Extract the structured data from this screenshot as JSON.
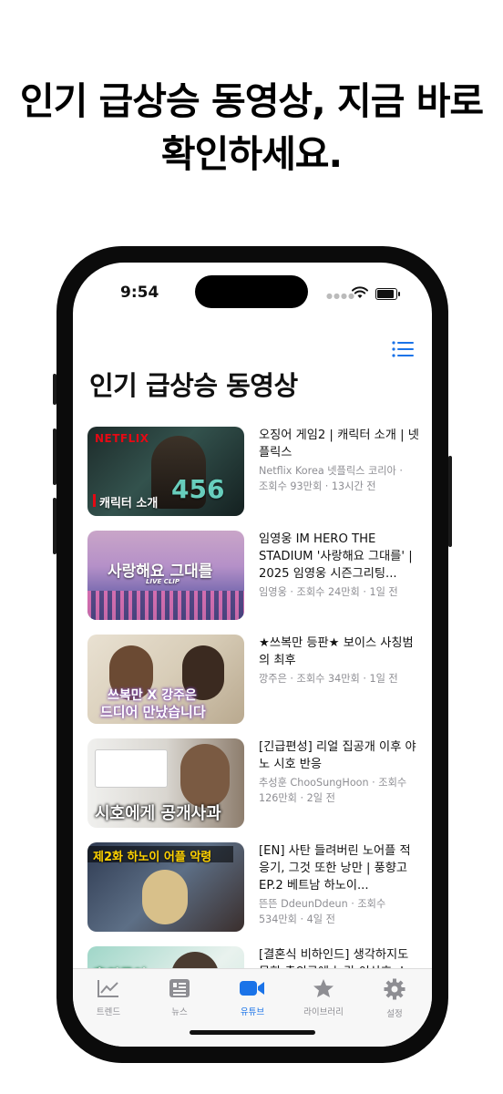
{
  "headline": {
    "line1": "인기 급상승 동영상, 지금 바로",
    "line2": "확인하세요."
  },
  "status_bar": {
    "time": "9:54"
  },
  "page": {
    "title": "인기 급상승 동영상"
  },
  "videos": [
    {
      "title": "오징어 게임2 | 캐릭터 소개 | 넷플릭스",
      "sub1": "Netflix Korea 넷플릭스 코리아 ·",
      "sub2": "조회수 93만회 · 13시간 전",
      "thumb_brand": "NETFLIX",
      "thumb_caption": "캐릭터 소개",
      "thumb_number": "456"
    },
    {
      "title": "임영웅 IM HERO THE STADIUM '사랑해요 그대를' | 2025 임영웅 시즌그리팅...",
      "sub1": "임영웅 · 조회수 24만회 · 1일 전",
      "sub2": "",
      "thumb_caption": "사랑해요 그대를",
      "thumb_small": "LIVE CLIP"
    },
    {
      "title": "★쓰복만 등판★ 보이스 사칭범의 최후",
      "sub1": "깡주은 · 조회수 34만회 · 1일 전",
      "sub2": "",
      "thumb_caption1": "쓰복만 X 강주은",
      "thumb_caption2": "드디어 만났습니다"
    },
    {
      "title": "[긴급편성] 리얼 집공개 이후 야노 시호 반응",
      "sub1": "추성훈 ChooSungHoon · 조회수",
      "sub2": "126만회 · 2일 전",
      "thumb_caption": "시호에게 공개사과"
    },
    {
      "title": "[EN] 사탄 들려버린 노어플 적응기, 그것 또한 낭만 | 풍향고 EP.2 베트남 하노이...",
      "sub1": "뜬뜬 DdeunDdeun · 조회수",
      "sub2": "534만회 · 4일 전",
      "thumb_caption": "제2화 하노이 어플 악령"
    },
    {
      "title": "[결혼식 비하인드] 생각하지도 못한 축의금에 놀란 이상호..!",
      "sub1": "",
      "sub2": "",
      "thumb_caption": "축의금이.."
    }
  ],
  "tabs": [
    {
      "label": "트렌드",
      "icon": "chart-icon",
      "active": false
    },
    {
      "label": "뉴스",
      "icon": "newspaper-icon",
      "active": false
    },
    {
      "label": "유튜브",
      "icon": "video-camera-icon",
      "active": true
    },
    {
      "label": "라이브러리",
      "icon": "star-icon",
      "active": false
    },
    {
      "label": "설정",
      "icon": "gear-icon",
      "active": false
    }
  ],
  "colors": {
    "accent": "#1a73e8",
    "inactive": "#8e8e93"
  }
}
